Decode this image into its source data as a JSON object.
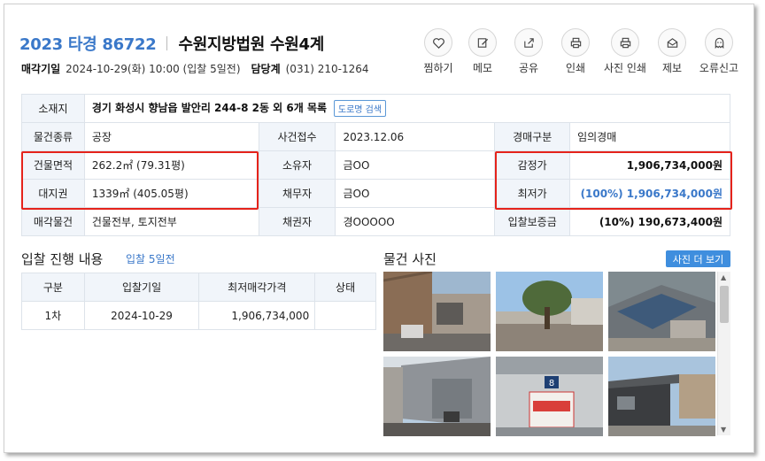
{
  "header": {
    "case_no": "2023 타경 86722",
    "court": "수원지방법원 수원4계",
    "sale_date_label": "매각기일",
    "sale_date_value": "2024-10-29(화) 10:00 (입찰 5일전)",
    "dept_label": "담당계",
    "dept_value": "(031) 210-1264"
  },
  "actions": [
    {
      "label": "찜하기",
      "icon": "heart-icon"
    },
    {
      "label": "메모",
      "icon": "pencil-icon"
    },
    {
      "label": "공유",
      "icon": "share-icon"
    },
    {
      "label": "인쇄",
      "icon": "print-icon"
    },
    {
      "label": "사진 인쇄",
      "icon": "photo-print-icon"
    },
    {
      "label": "제보",
      "icon": "envelope-icon"
    },
    {
      "label": "오류신고",
      "icon": "ghost-icon"
    }
  ],
  "info": {
    "location_label": "소재지",
    "location_value": "경기 화성시 향남읍 발안리 244-8 2동 외 6개 목록",
    "road_search_label": "도로명 검색",
    "type_label": "물건종류",
    "type_value": "공장",
    "filed_label": "사건접수",
    "filed_value": "2023.12.06",
    "auction_type_label": "경매구분",
    "auction_type_value": "임의경매",
    "building_area_label": "건물면적",
    "building_area_value": "262.2㎡ (79.31평)",
    "owner_label": "소유자",
    "owner_value": "금OO",
    "appraisal_label": "감정가",
    "appraisal_value": "1,906,734,000원",
    "land_label": "대지권",
    "land_value": "1339㎡ (405.05평)",
    "debtor_label": "채무자",
    "debtor_value": "금OO",
    "min_price_label": "최저가",
    "min_price_value": "(100%) 1,906,734,000원",
    "sale_object_label": "매각물건",
    "sale_object_value": "건물전부, 토지전부",
    "creditor_label": "채권자",
    "creditor_value": "경OOOOO",
    "deposit_label": "입찰보증금",
    "deposit_value": "(10%) 190,673,400원"
  },
  "bid_section": {
    "title": "입찰 진행 내용",
    "subtitle": "입찰 5일전",
    "headers": [
      "구분",
      "입찰기일",
      "최저매각가격",
      "상태"
    ],
    "rows": [
      {
        "round": "1차",
        "date": "2024-10-29",
        "price": "1,906,734,000",
        "status": ""
      }
    ]
  },
  "photo_section": {
    "title": "물건 사진",
    "more_label": "사진 더 보기",
    "count": 6
  },
  "colors": {
    "accent": "#3a78c9",
    "highlight": "#e5231b",
    "header_bg": "#f1f5fa",
    "button": "#3f8ede"
  }
}
